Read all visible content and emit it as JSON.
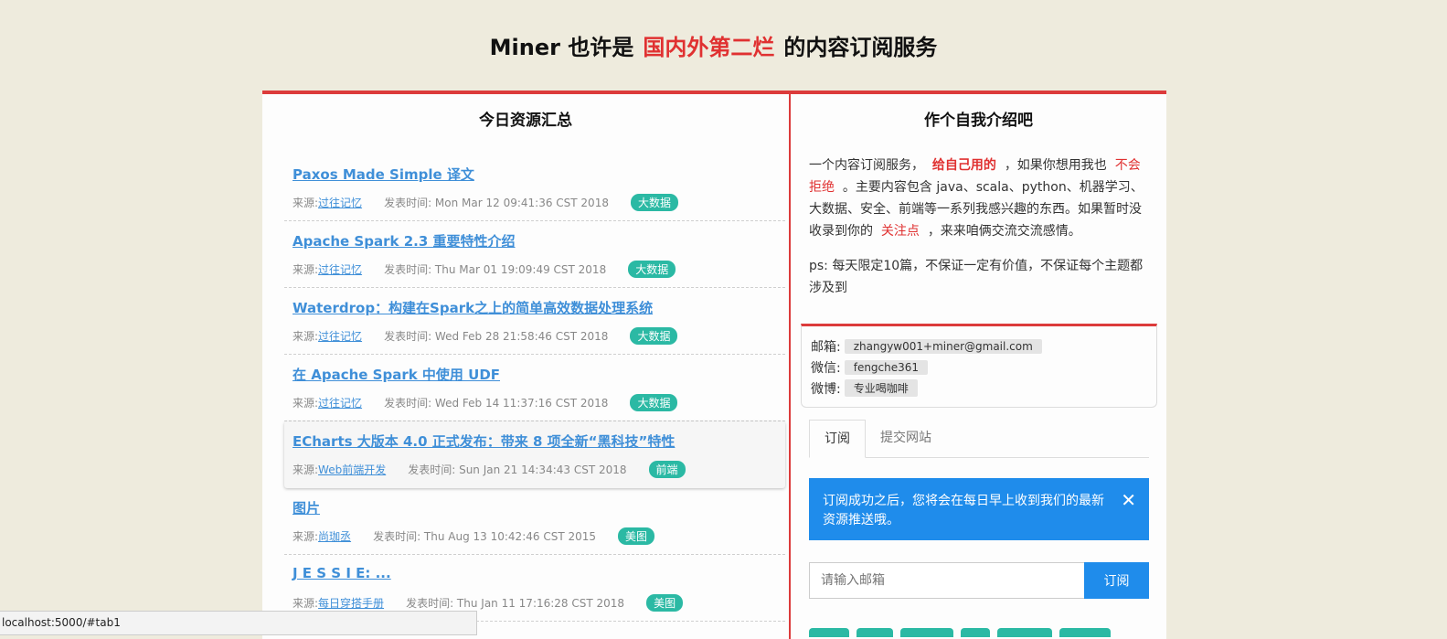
{
  "header": {
    "title_prefix": "Miner 也许是",
    "title_accent": "国内外第二烂",
    "title_suffix": "的内容订阅服务"
  },
  "left_panel": {
    "heading": "今日资源汇总",
    "source_label": "来源: ",
    "time_label": "发表时间: ",
    "articles": [
      {
        "title": "Paxos Made Simple 译文",
        "source": "过往记忆",
        "time": "Mon Mar 12 09:41:36 CST 2018",
        "tag": "大数据"
      },
      {
        "title": "Apache Spark 2.3 重要特性介绍",
        "source": "过往记忆",
        "time": "Thu Mar 01 19:09:49 CST 2018",
        "tag": "大数据"
      },
      {
        "title": "Waterdrop：构建在Spark之上的简单高效数据处理系统",
        "source": "过往记忆",
        "time": "Wed Feb 28 21:58:46 CST 2018",
        "tag": "大数据"
      },
      {
        "title": "在 Apache Spark 中使用 UDF",
        "source": "过往记忆",
        "time": "Wed Feb 14 11:37:16 CST 2018",
        "tag": "大数据"
      },
      {
        "title": "ECharts 大版本 4.0 正式发布：带来 8 项全新“黑科技”特性",
        "source": "Web前端开发",
        "time": "Sun Jan 21 14:34:43 CST 2018",
        "tag": "前端"
      },
      {
        "title": "图片",
        "source": "尚珈丞",
        "time": "Thu Aug 13 10:42:46 CST 2015",
        "tag": "美图"
      },
      {
        "title": "J E S S I E: ...",
        "source": "每日穿搭手册",
        "time": "Thu Jan 11 17:16:28 CST 2018",
        "tag": "美图"
      }
    ]
  },
  "right_panel": {
    "heading": "作个自我介绍吧",
    "intro": {
      "p1_a": "一个内容订阅服务，",
      "p1_b": "给自己用的",
      "p1_c": "，如果你想用我也",
      "p1_d": "不会拒绝",
      "p1_e": "。主要内容包含 java、scala、python、机器学习、大数据、安全、前端等一系列我感兴趣的东西。如果暂时没收录到你的",
      "p1_f": "关注点",
      "p1_g": "，来来咱俩交流交流感情。",
      "p2": "ps: 每天限定10篇，不保证一定有价值，不保证每个主题都涉及到"
    },
    "contacts": [
      {
        "label": "邮箱:",
        "value": "zhangyw001+miner@gmail.com"
      },
      {
        "label": "微信:",
        "value": "fengche361"
      },
      {
        "label": "微博:",
        "value": "专业喝咖啡"
      }
    ],
    "tabs": [
      {
        "label": "订阅"
      },
      {
        "label": "提交网站"
      }
    ],
    "alert": {
      "text": "订阅成功之后，您将会在每日早上收到我们的最新资源推送哦。",
      "close": "✕"
    },
    "subscribe": {
      "placeholder": "请输入邮箱",
      "button": "订阅"
    },
    "colors": {
      "accent": "#dc3b3b",
      "primary": "#1f8ceb",
      "tag": "#2bb9a4"
    }
  },
  "status_bar": {
    "url": "localhost:5000/#tab1"
  }
}
